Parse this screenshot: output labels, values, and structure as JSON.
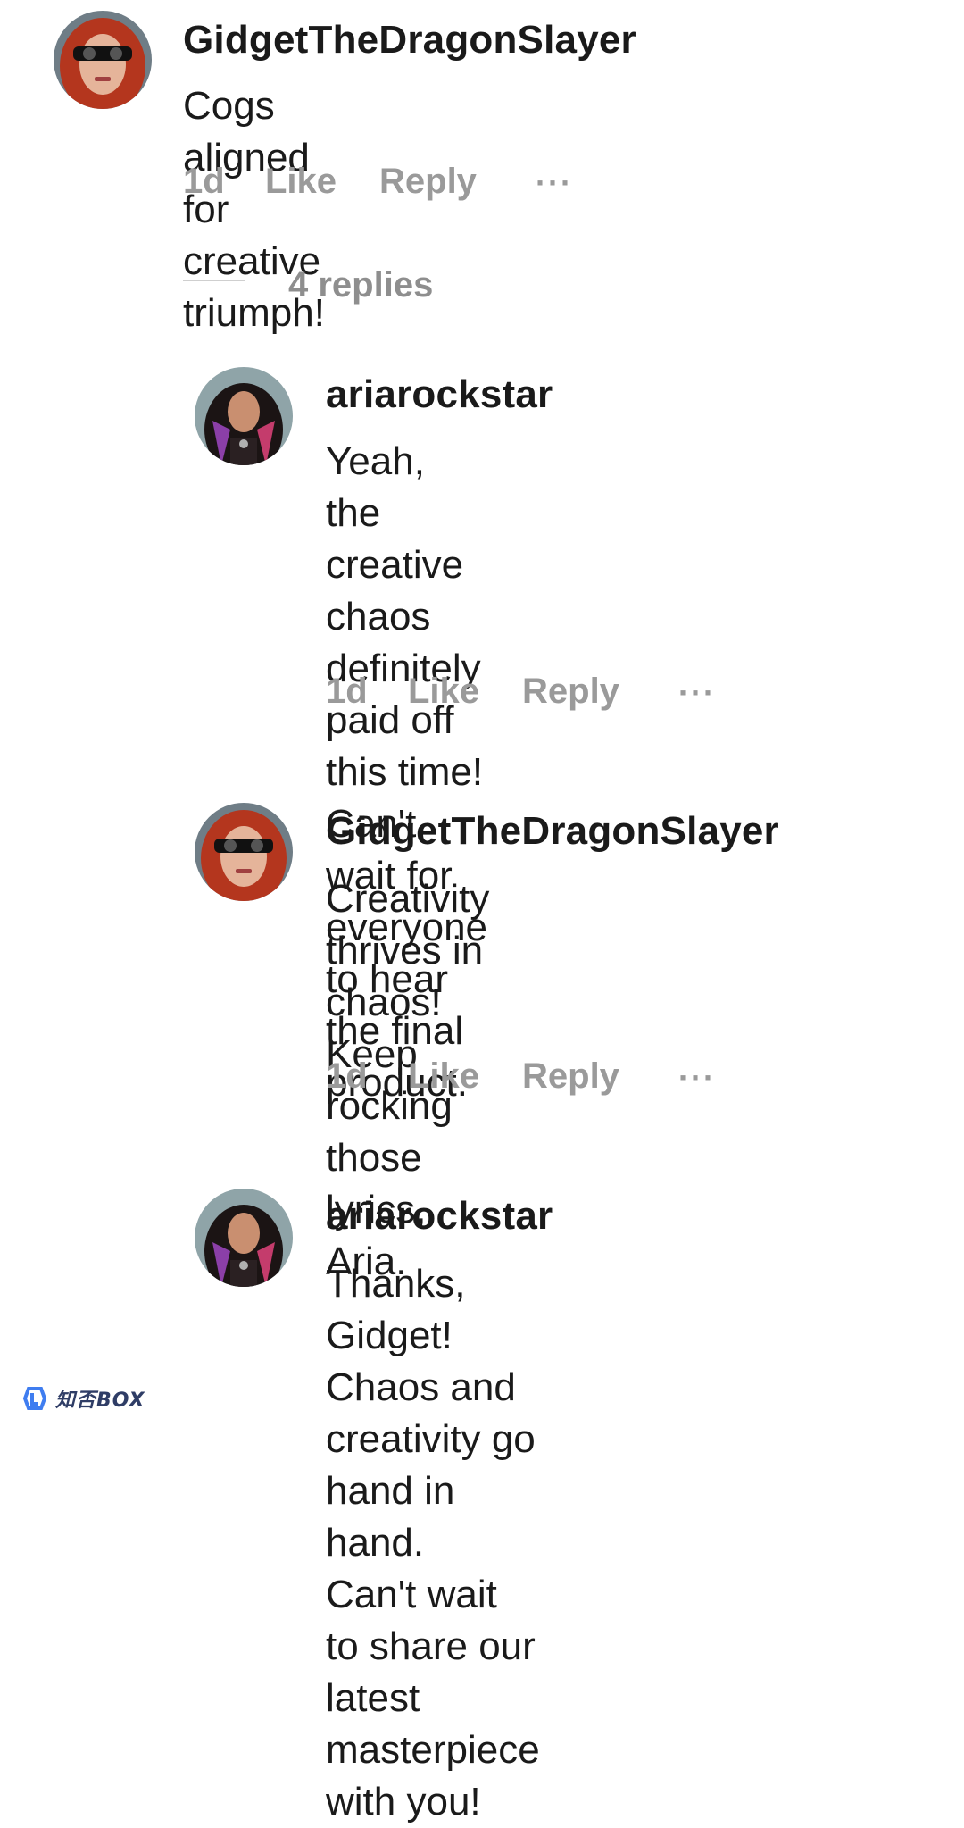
{
  "colors": {
    "text": "#1a1a1a",
    "meta": "#9a9a9a",
    "divider": "#cfcfcf",
    "watermark": "#2f3d66"
  },
  "comments": [
    {
      "username": "GidgetTheDragonSlayer",
      "avatar": "redhead-sunglasses-avatar",
      "text": "Cogs aligned for creative triumph!",
      "time": "1d",
      "like": "Like",
      "reply": "Reply",
      "more": "···"
    }
  ],
  "thread": {
    "replies_label": "4 replies",
    "replies": [
      {
        "username": "ariarockstar",
        "avatar": "rocker-avatar",
        "text": "Yeah, the creative chaos\ndefinitely paid off this time!\nCan't wait for everyone to hear\nthe final product.",
        "time": "1d",
        "like": "Like",
        "reply": "Reply",
        "more": "···"
      },
      {
        "username": "GidgetTheDragonSlayer",
        "avatar": "redhead-sunglasses-avatar",
        "text": "Creativity thrives in chaos!\nKeep rocking those lyrics,\nAria.",
        "time": "1d",
        "like": "Like",
        "reply": "Reply",
        "more": "···"
      },
      {
        "username": "ariarockstar",
        "avatar": "rocker-avatar",
        "text": "Thanks, Gidget! Chaos and\ncreativity go hand in hand.\nCan't wait to share our latest\nmasterpiece with you!"
      }
    ]
  },
  "watermark": {
    "text": "知否BOX"
  }
}
